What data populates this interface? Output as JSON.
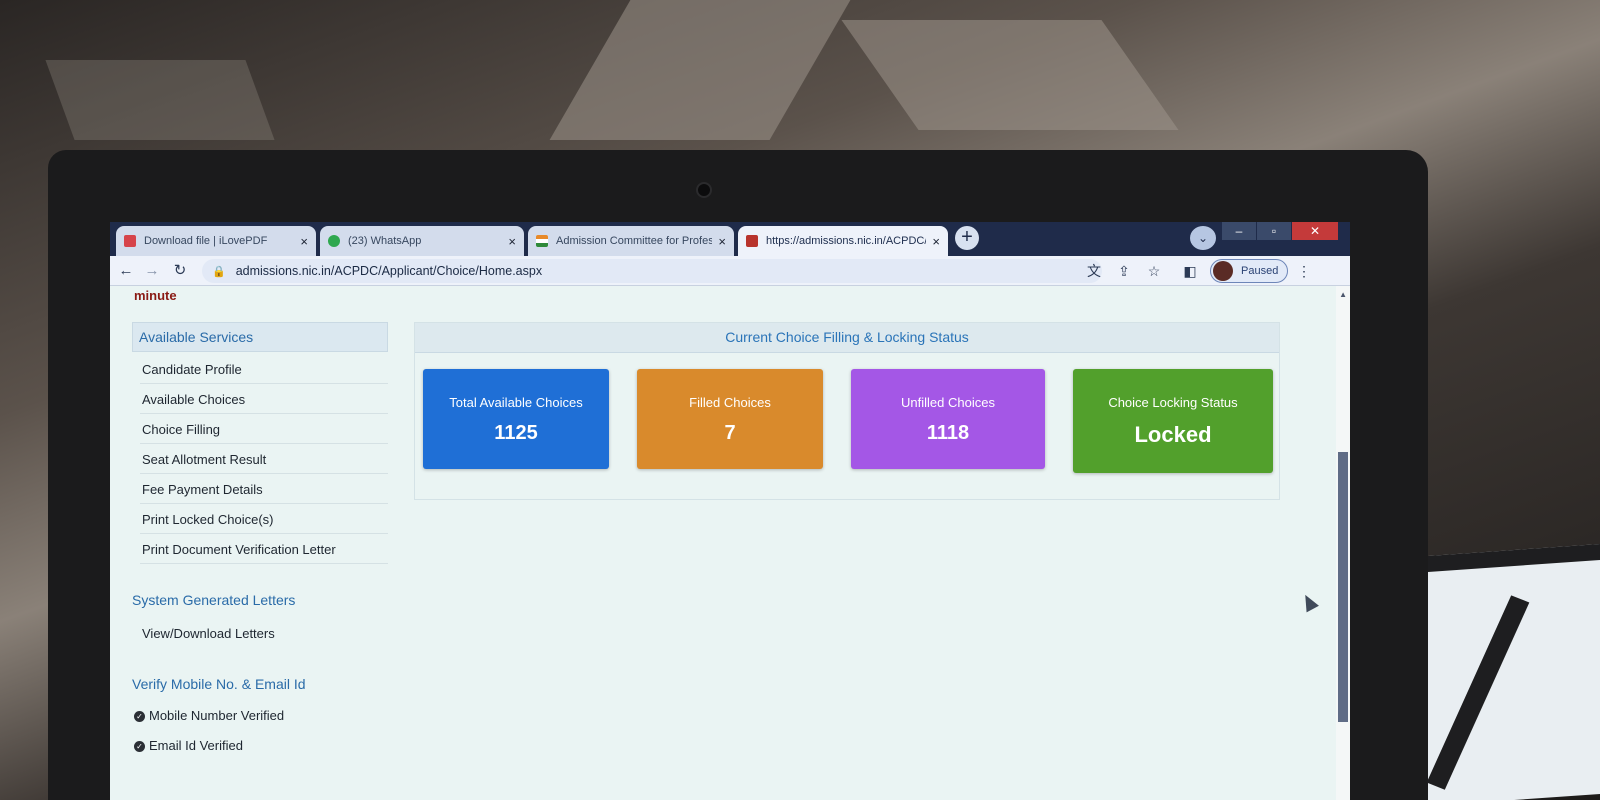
{
  "browser": {
    "tabs": [
      {
        "title": "Download file | iLovePDF",
        "favicon_color": "#d6434a",
        "active": false
      },
      {
        "title": "(23) WhatsApp",
        "favicon_color": "#2fa84f",
        "active": false
      },
      {
        "title": "Admission Committee for Profes",
        "favicon_color": "#e88a2a",
        "active": false
      },
      {
        "title": "https://admissions.nic.in/ACPDC/",
        "favicon_color": "#b8332c",
        "active": true
      }
    ],
    "tab_close_glyph": "×",
    "new_tab_glyph": "+",
    "url": "admissions.nic.in/ACPDC/Applicant/Choice/Home.aspx",
    "profile_status": "Paused"
  },
  "page": {
    "top_text": "minute",
    "sidebar": {
      "available_services": {
        "title": "Available Services",
        "items": [
          "Candidate Profile",
          "Available Choices",
          "Choice Filling",
          "Seat Allotment Result",
          "Fee Payment Details",
          "Print Locked Choice(s)",
          "Print Document Verification Letter"
        ]
      },
      "system_letters": {
        "title": "System Generated Letters",
        "items": [
          "View/Download Letters"
        ]
      },
      "verify": {
        "title": "Verify Mobile No. & Email Id",
        "items": [
          "Mobile Number Verified",
          "Email Id Verified"
        ]
      }
    },
    "status": {
      "title": "Current Choice Filling & Locking Status",
      "cards": [
        {
          "label": "Total Available Choices",
          "value": "1125",
          "color": "#1f6fd6"
        },
        {
          "label": "Filled Choices",
          "value": "7",
          "color": "#d98a2c"
        },
        {
          "label": "Unfilled Choices",
          "value": "1118",
          "color": "#a457e6"
        },
        {
          "label": "Choice Locking Status",
          "value": "Locked",
          "color": "#52a02c"
        }
      ]
    }
  }
}
